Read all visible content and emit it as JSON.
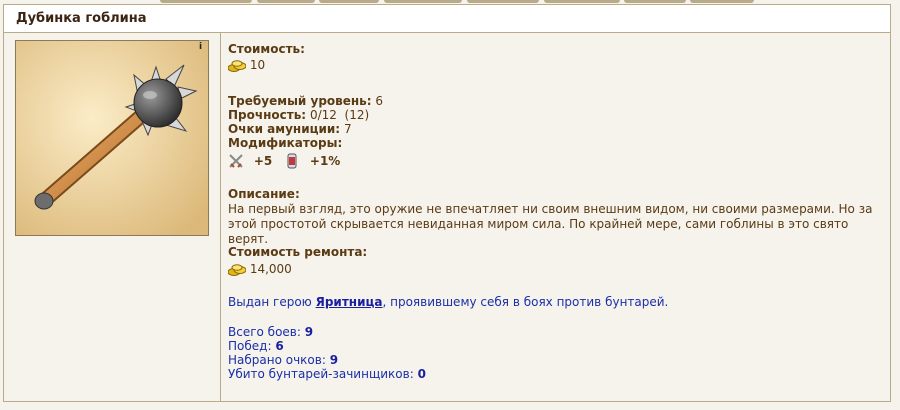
{
  "item": {
    "title": "Дубинка гоблина",
    "info_badge": "i"
  },
  "stats": {
    "cost_label": "Стоимость:",
    "cost_value": "10",
    "level_label": "Требуемый уровень:",
    "level_value": "6",
    "durability_label": "Прочность:",
    "durability_value": "0/12  (12)",
    "ammo_label": "Очки амуниции:",
    "ammo_value": "7",
    "modifiers_label": "Модификаторы:",
    "modifiers": [
      {
        "icon": "crossed-swords-icon",
        "value": "+5"
      },
      {
        "icon": "scroll-icon",
        "value": "+1%"
      }
    ],
    "description_label": "Описание:",
    "description": "На первый взгляд, это оружие не впечатляет ни своим внешним видом, ни своими размерами. Но за этой простотой скрывается невиданная миром сила. По крайней мере, сами гоблины в это свято верят.",
    "repair_label": "Стоимость ремонта:",
    "repair_value": "14,000"
  },
  "award": {
    "prefix": "Выдан герою ",
    "hero": "Яритница",
    "suffix": ", проявившему себя в боях против бунтарей."
  },
  "battles": [
    {
      "label": "Всего боев: ",
      "value": "9"
    },
    {
      "label": "Побед: ",
      "value": "6"
    },
    {
      "label": "Набрано очков: ",
      "value": "9"
    },
    {
      "label": "Убито бунтарей-зачинщиков: ",
      "value": "0"
    }
  ]
}
